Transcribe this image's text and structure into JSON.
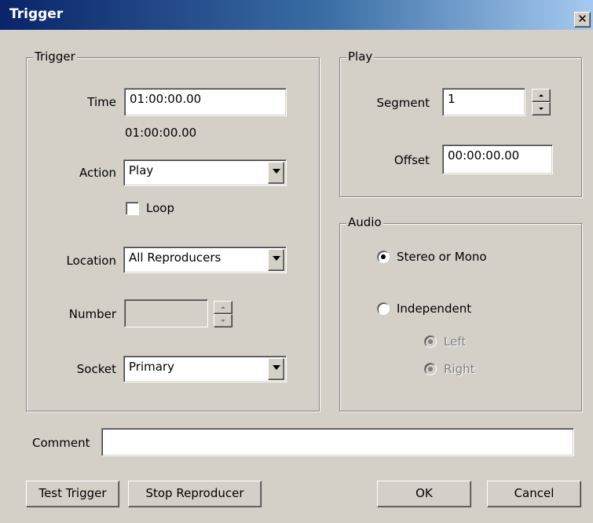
{
  "window": {
    "title": "Trigger",
    "close_glyph": "✕"
  },
  "trigger_group": {
    "legend": "Trigger",
    "time_label": "Time",
    "time_value": "01:00:00.00",
    "time_display": "01:00:00.00",
    "action_label": "Action",
    "action_value": "Play",
    "loop_label": "Loop",
    "loop_checked": false,
    "location_label": "Location",
    "location_value": "All Reproducers",
    "number_label": "Number",
    "number_value": "",
    "socket_label": "Socket",
    "socket_value": "Primary"
  },
  "play_group": {
    "legend": "Play",
    "segment_label": "Segment",
    "segment_value": "1",
    "offset_label": "Offset",
    "offset_value": "00:00:00.00"
  },
  "audio_group": {
    "legend": "Audio",
    "stereo_label": "Stereo or Mono",
    "stereo_selected": true,
    "independent_label": "Independent",
    "independent_selected": false,
    "left_label": "Left",
    "right_label": "Right"
  },
  "comment": {
    "label": "Comment",
    "value": ""
  },
  "buttons": {
    "test_trigger": "Test Trigger",
    "stop_reproducer": "Stop Reproducer",
    "ok": "OK",
    "cancel": "Cancel"
  }
}
